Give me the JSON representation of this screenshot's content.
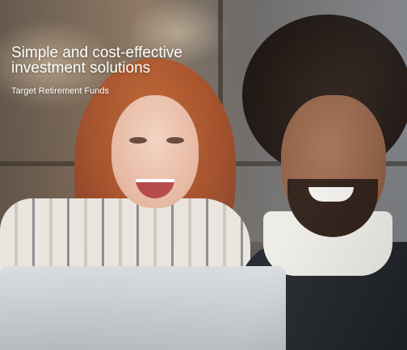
{
  "hero": {
    "headline_line1": "Simple and cost-effective",
    "headline_line2": "investment solutions",
    "subheadline": "Target Retirement Funds"
  }
}
